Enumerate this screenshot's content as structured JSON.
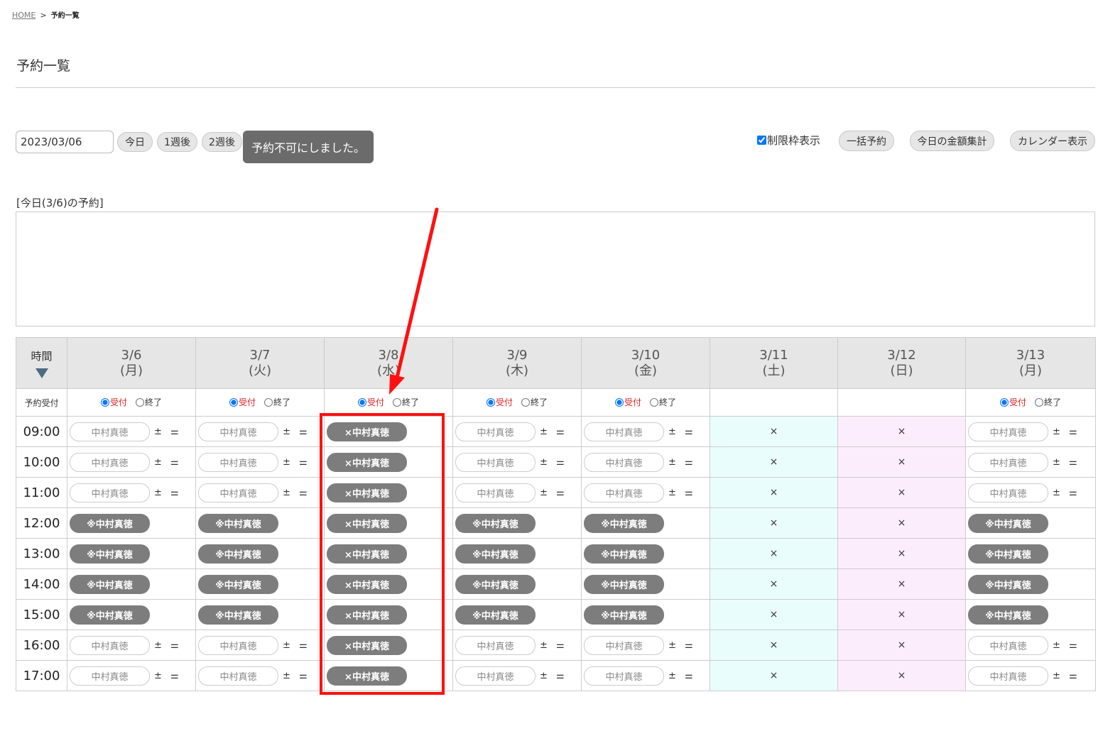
{
  "breadcrumb": {
    "home": "HOME",
    "sep": ">",
    "current": "予約一覧"
  },
  "page_title": "予約一覧",
  "controls": {
    "date_value": "2023/03/06",
    "today": "今日",
    "week1": "1週後",
    "week2": "2週後",
    "toast": "予約不可にしました。",
    "limit_checkbox": "制限枠表示",
    "bulk": "一括予約",
    "daily_total": "今日の金額集計",
    "calendar": "カレンダー表示"
  },
  "today_section": {
    "label": "[今日(3/6)の予約]"
  },
  "table": {
    "time_header": "時間",
    "accept_row_label": "予約受付",
    "accept_label": "受付",
    "end_label": "終了",
    "pm_symbol": "± ⚌",
    "days": [
      {
        "date": "3/6",
        "dow": "(月)"
      },
      {
        "date": "3/7",
        "dow": "(火)"
      },
      {
        "date": "3/8",
        "dow": "(水)"
      },
      {
        "date": "3/9",
        "dow": "(木)"
      },
      {
        "date": "3/10",
        "dow": "(金)"
      },
      {
        "date": "3/11",
        "dow": "(土)"
      },
      {
        "date": "3/12",
        "dow": "(日)"
      },
      {
        "date": "3/13",
        "dow": "(月)"
      }
    ],
    "times": [
      "09:00",
      "10:00",
      "11:00",
      "12:00",
      "13:00",
      "14:00",
      "15:00",
      "16:00",
      "17:00"
    ],
    "name": "中村真徳",
    "reserved_badge": "※中村真徳",
    "blocked_badge": "×中村真徳",
    "closed_mark": "×"
  },
  "colors": {
    "annotation": "#ff1010",
    "badge": "#7d7d7d",
    "saturday": "#eafdfd",
    "sunday": "#fcedfc",
    "accent_red": "#e02020"
  }
}
